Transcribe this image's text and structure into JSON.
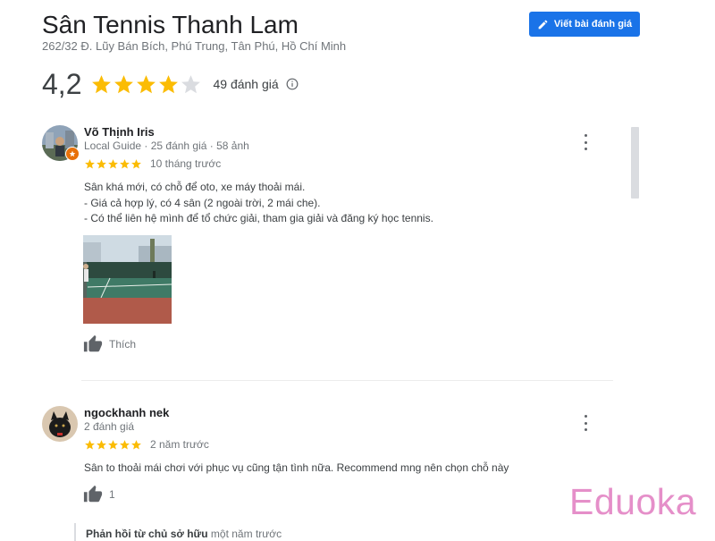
{
  "header": {
    "title": "Sân Tennis Thanh Lam",
    "address": "262/32 Đ. Lũy Bán Bích, Phú Trung, Tân Phú, Hồ Chí Minh",
    "write_review_label": "Viết bài đánh giá"
  },
  "summary": {
    "rating": "4,2",
    "rating_value": 4.2,
    "stars_filled": 4,
    "review_count": "49 đánh giá"
  },
  "reviews": [
    {
      "name": "Võ Thịnh Iris",
      "meta": "Local Guide · 25 đánh giá · 58 ảnh",
      "stars": 5,
      "date": "10 tháng trước",
      "text": [
        "Sân khá mới, có chỗ để oto, xe máy thoải mái.",
        "- Giá cả hợp lý, có 4 sân (2 ngoài trời, 2 mái che).",
        "- Có thể liên hệ mình để tổ chức giải, tham gia giải và đăng ký học tennis."
      ],
      "like_label": "Thích"
    },
    {
      "name": "ngockhanh nek",
      "meta": "2 đánh giá",
      "stars": 5,
      "date": "2 năm trước",
      "text": [
        "Sân to thoải mái chơi với phục vụ cũng tận tình nữa. Recommend mng nên chọn chỗ này"
      ],
      "like_label": "1"
    }
  ],
  "owner_reply": {
    "label": "Phản hồi từ chủ sở hữu",
    "time": "một năm trước"
  },
  "watermark": "Eduoka",
  "colors": {
    "accent": "#1a73e8",
    "star": "#fbbc04",
    "watermark": "#e58fc9"
  }
}
